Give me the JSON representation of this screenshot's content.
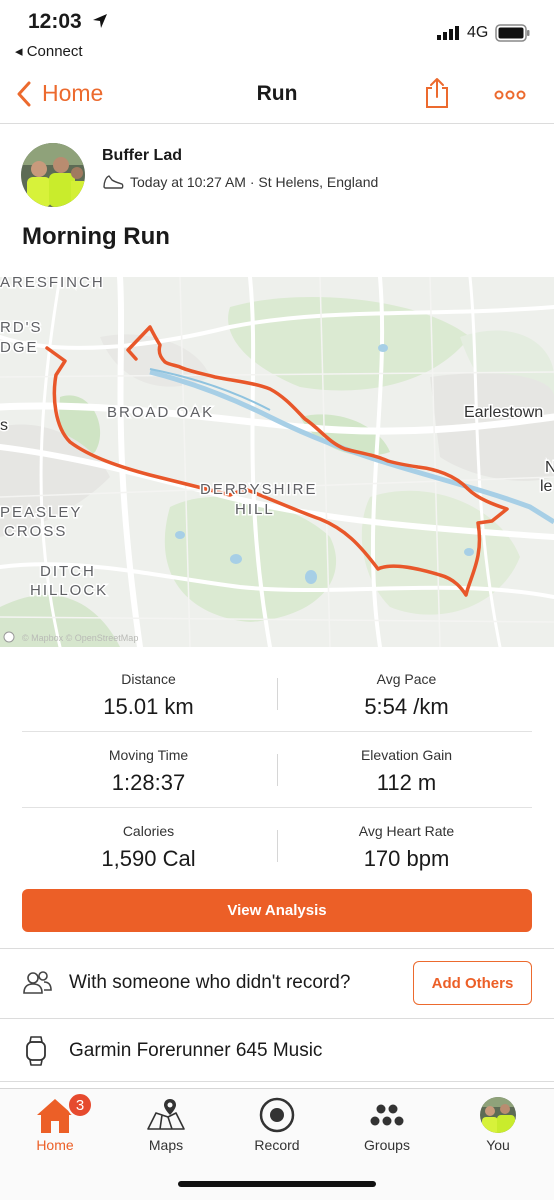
{
  "status_bar": {
    "time": "12:03",
    "back_app": "◂ Connect",
    "network": "4G"
  },
  "nav": {
    "back_label": "Home",
    "title": "Run"
  },
  "activity": {
    "athlete_name": "Buffer Lad",
    "meta": "Today at 10:27 AM · St Helens, England",
    "title": "Morning Run"
  },
  "map": {
    "place_labels": [
      "ARESFINCH",
      "RD'S",
      "DGE",
      "BROAD OAK",
      "Earlestown",
      "DERBYSHIRE",
      "HILL",
      "PEASLEY",
      "CROSS",
      "DITCH",
      "HILLOCK",
      "s",
      "N",
      "le"
    ],
    "attribution": "© Mapbox © OpenStreetMap",
    "route_color": "#e8572a"
  },
  "stats": [
    {
      "label": "Distance",
      "value": "15.01 km"
    },
    {
      "label": "Avg Pace",
      "value": "5:54 /km"
    },
    {
      "label": "Moving Time",
      "value": "1:28:37"
    },
    {
      "label": "Elevation Gain",
      "value": "112 m"
    },
    {
      "label": "Calories",
      "value": "1,590 Cal"
    },
    {
      "label": "Avg Heart Rate",
      "value": "170 bpm"
    }
  ],
  "actions": {
    "view_analysis": "View Analysis",
    "with_someone": "With someone who didn't record?",
    "add_others": "Add Others",
    "device": "Garmin Forerunner 645 Music"
  },
  "tabbar": {
    "home_badge": "3",
    "tabs": [
      {
        "label": "Home",
        "icon": "home-icon",
        "active": true
      },
      {
        "label": "Maps",
        "icon": "maps-icon"
      },
      {
        "label": "Record",
        "icon": "record-icon"
      },
      {
        "label": "Groups",
        "icon": "groups-icon"
      },
      {
        "label": "You",
        "icon": "profile-avatar"
      }
    ]
  },
  "colors": {
    "accent": "#ec5f27",
    "text": "#1a1a1a"
  }
}
